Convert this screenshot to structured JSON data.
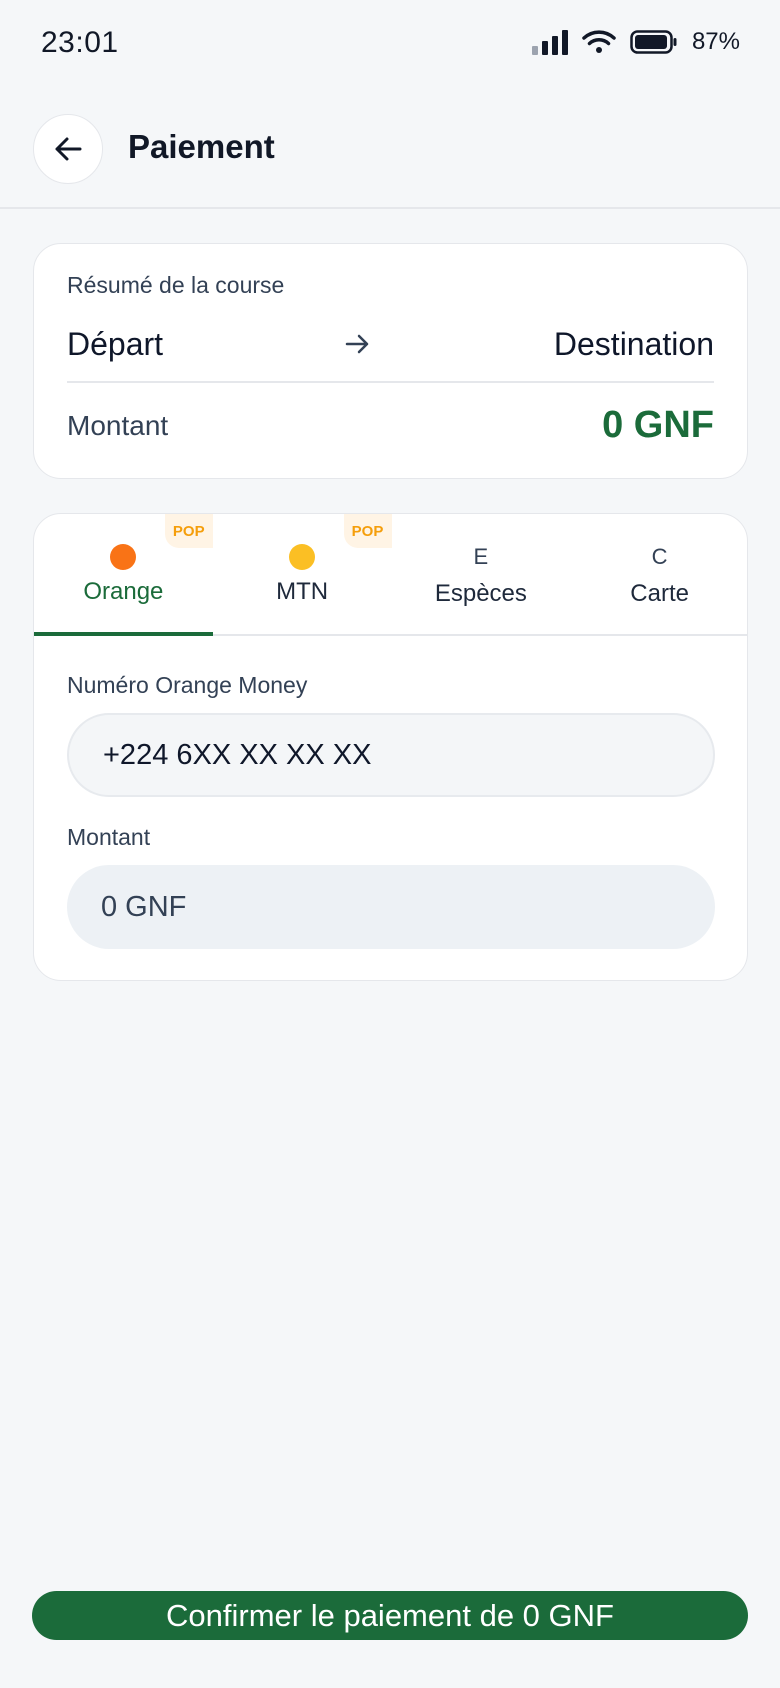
{
  "status_bar": {
    "time": "23:01",
    "battery": "87%"
  },
  "header": {
    "title": "Paiement",
    "back_icon": "arrow-left-icon"
  },
  "summary": {
    "label": "Résumé de la course",
    "from": "Départ",
    "to": "Destination",
    "amount_label": "Montant",
    "amount_value": "0 GNF"
  },
  "tabs": [
    {
      "label": "Orange",
      "icon": "orange-dot",
      "icon_color": "#f97316",
      "badge": "POP",
      "active": true
    },
    {
      "label": "MTN",
      "icon": "yellow-dot",
      "icon_color": "#fbbf24",
      "badge": "POP",
      "active": false
    },
    {
      "label": "Espèces",
      "icon_text": "E",
      "active": false
    },
    {
      "label": "Carte",
      "icon_text": "C",
      "active": false
    }
  ],
  "form": {
    "phone_label": "Numéro Orange Money",
    "phone_value": "+224 6XX XX XX XX",
    "amount_label": "Montant",
    "amount_value": "0 GNF"
  },
  "confirm_button": "Confirmer le paiement de 0 GNF",
  "colors": {
    "primary": "#1b6b3a",
    "badge": "#f59e0b",
    "background": "#f5f7f9"
  }
}
